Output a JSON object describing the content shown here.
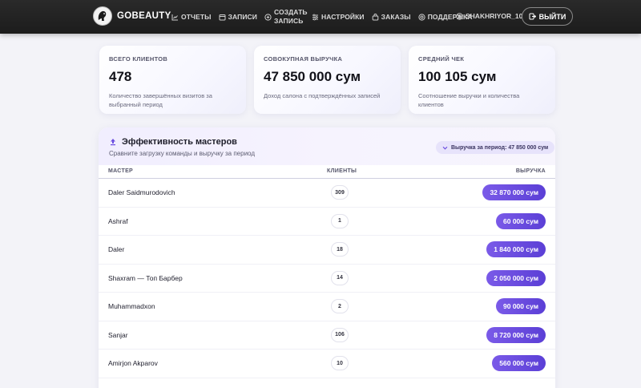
{
  "brand": {
    "name": "GOBEAUTY"
  },
  "nav": {
    "items": [
      {
        "label": "ОТЧЕТЫ",
        "icon": "chart-icon"
      },
      {
        "label": "ЗАПИСИ",
        "icon": "calendar-icon"
      },
      {
        "label": "СОЗДАТЬ ЗАПИСЬ",
        "icon": "plus-circle-icon"
      },
      {
        "label": "НАСТРОЙКИ",
        "icon": "settings-icon"
      },
      {
        "label": "ЗАКАЗЫ",
        "icon": "bag-icon"
      },
      {
        "label": "ПОДДЕРЖКА",
        "icon": "support-icon"
      }
    ],
    "user": "SHAKHRIYOR_10",
    "logout": "ВЫЙТИ"
  },
  "stats": [
    {
      "title": "ВСЕГО КЛИЕНТОВ",
      "value": "478",
      "desc": "Количество завершённых визитов за выбранный период"
    },
    {
      "title": "СОВОКУПНАЯ ВЫРУЧКА",
      "value": "47 850 000 сум",
      "desc": "Доход салона с подтверждённых записей"
    },
    {
      "title": "СРЕДНИЙ ЧЕК",
      "value": "100 105 сум",
      "desc": "Соотношение выручки и количества клиентов"
    }
  ],
  "masters": {
    "title": "Эффективность мастеров",
    "subtitle": "Сравните загрузку команды и выручку за период",
    "period_badge": "Выручка за период: 47 850 000 сум",
    "columns": {
      "master": "МАСТЕР",
      "clients": "КЛИЕНТЫ",
      "revenue": "ВЫРУЧКА"
    },
    "rows": [
      {
        "name": "Daler Saidmurodovich",
        "clients": "309",
        "revenue": "32 870 000 сум"
      },
      {
        "name": "Ashraf",
        "clients": "1",
        "revenue": "60 000 сум"
      },
      {
        "name": "Daler",
        "clients": "18",
        "revenue": "1 840 000 сум"
      },
      {
        "name": "Shaxram — Топ Барбер",
        "clients": "14",
        "revenue": "2 050 000 сум"
      },
      {
        "name": "Muhammadxon",
        "clients": "2",
        "revenue": "90 000 сум"
      },
      {
        "name": "Sanjar",
        "clients": "106",
        "revenue": "8 720 000 сум"
      },
      {
        "name": "Amirjon Akparov",
        "clients": "10",
        "revenue": "560 000 сум"
      }
    ]
  },
  "colors": {
    "accent": "#6a4ce0",
    "header_bg": "#222222",
    "page_bg": "#f3f3f8"
  }
}
